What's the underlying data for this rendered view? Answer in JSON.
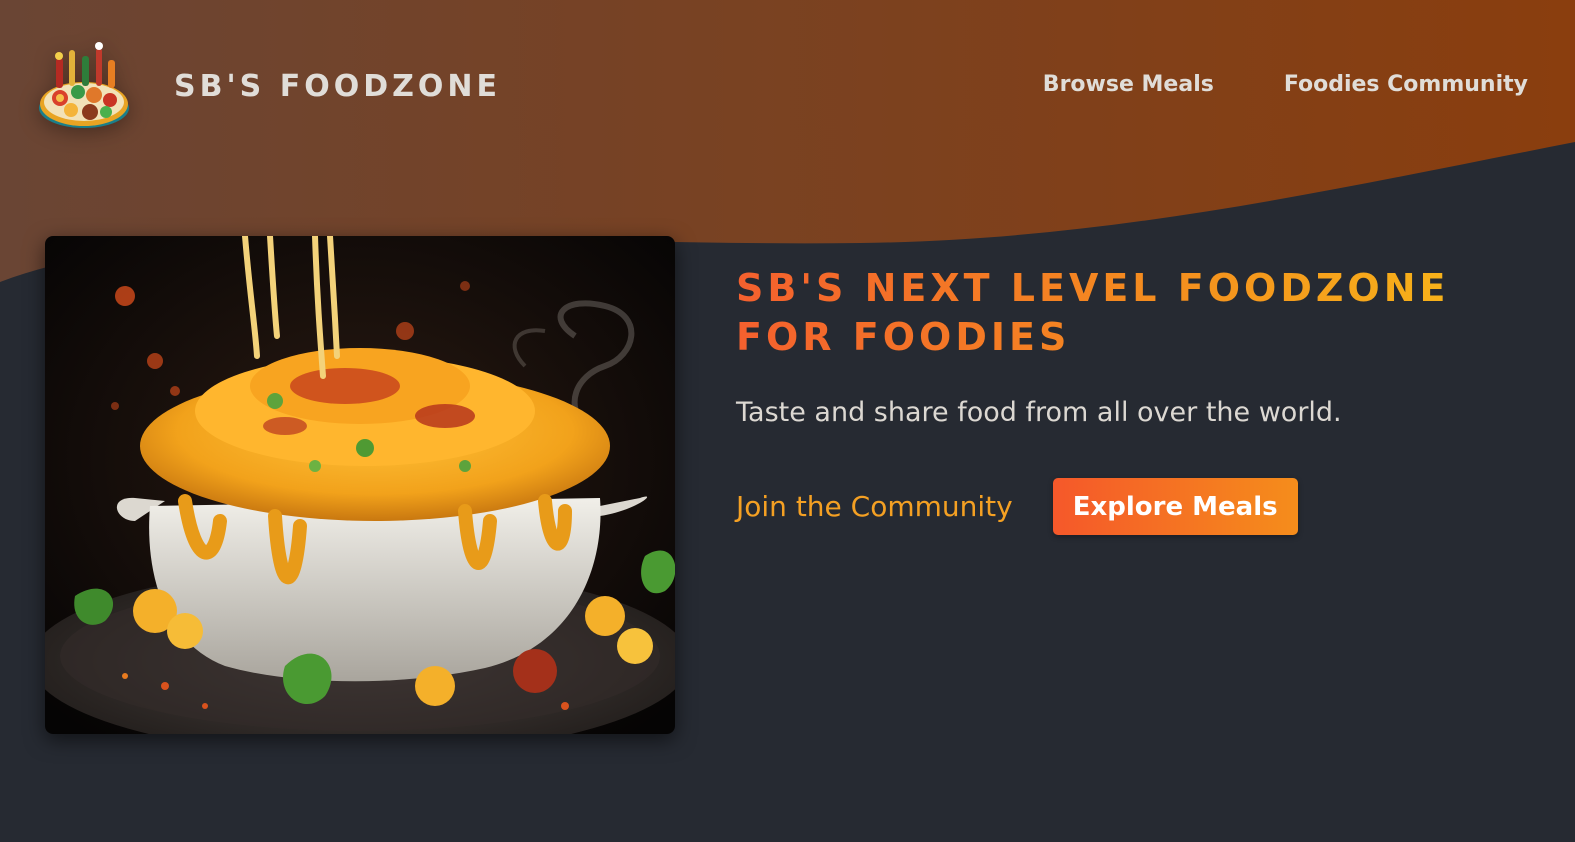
{
  "colors": {
    "page_background": "#262a32",
    "header_gradient_start": "#6a4534",
    "header_gradient_end": "#8a3e0e",
    "brand_text": "#e0ddd8",
    "title_gradient": [
      "#f4602e",
      "#f48f1e",
      "#f8bd18"
    ],
    "accent_orange": "#f4a023",
    "button_gradient": [
      "#f5582a",
      "#f58d1b"
    ]
  },
  "header": {
    "logo_alt": "A plate with food on it",
    "logo_icon": "food-platter-logo",
    "brand_name": "SB'S FOODZONE"
  },
  "nav": {
    "items": [
      {
        "label": "Browse Meals"
      },
      {
        "label": "Foodies Community"
      }
    ]
  },
  "hero": {
    "image_alt": "A bowl of mac and cheese",
    "title": "SB'S NEXT LEVEL FOODZONE FOR FOODIES",
    "tagline": "Taste and share food from all over the world.",
    "community_link": "Join the Community",
    "explore_button": "Explore Meals"
  }
}
